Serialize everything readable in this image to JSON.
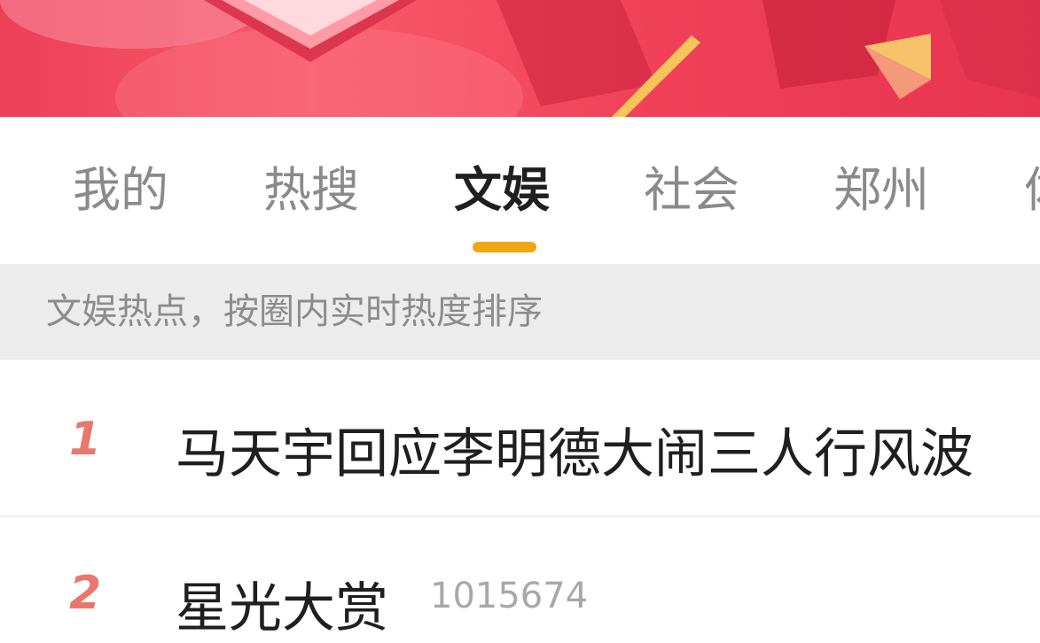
{
  "tabs": [
    {
      "label": "我的"
    },
    {
      "label": "热搜"
    },
    {
      "label": "文娱"
    },
    {
      "label": "社会"
    },
    {
      "label": "郑州"
    },
    {
      "label": "体"
    }
  ],
  "active_tab": "文娱",
  "colors": {
    "banner": "#f04a60",
    "tab_indicator": "#f2a712",
    "rank_color": "#e9776c",
    "hint_bar_bg": "#ececec"
  },
  "hint": "文娱热点，按圈内实时热度排序",
  "items": [
    {
      "rank": "1",
      "title": "马天宇回应李明德大闹三人行风波",
      "count": ""
    },
    {
      "rank": "2",
      "title": "星光大赏",
      "count": "1015674"
    }
  ]
}
